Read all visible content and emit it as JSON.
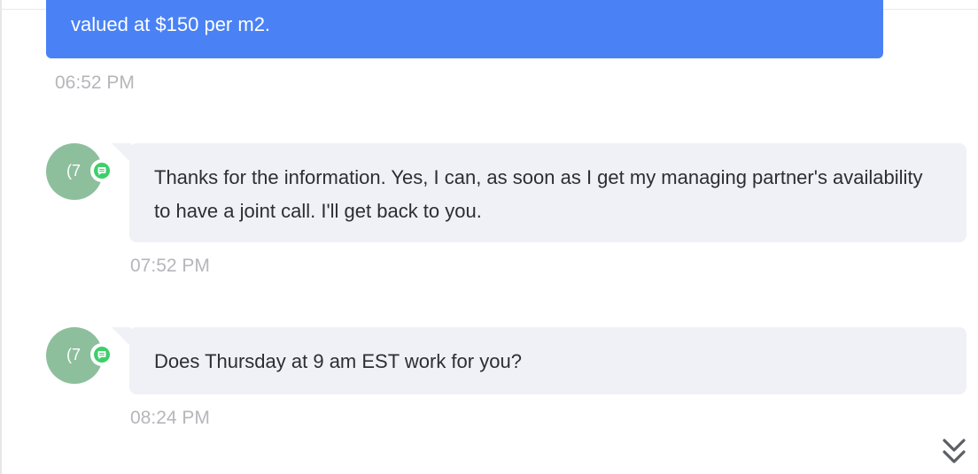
{
  "messages": {
    "outgoing_1": {
      "text": "valued at $150 per m2.",
      "time": "06:52 PM"
    },
    "incoming_1": {
      "avatar_initials": "(7",
      "text": "Thanks for the information. Yes, I can, as soon as I get my managing partner's availability to have a joint call. I'll get back to you.",
      "time": "07:52 PM"
    },
    "incoming_2": {
      "avatar_initials": "(7",
      "text": "Does Thursday at 9 am EST work for you?",
      "time": "08:24 PM"
    }
  },
  "icons": {
    "channel_badge": "chat-bubble-icon",
    "scroll_down": "double-chevron-down-icon"
  },
  "colors": {
    "outgoing_bubble": "#4a82f5",
    "incoming_bubble": "#f0f1f6",
    "avatar": "#8dbf9d",
    "channel_badge": "#3ecf6a",
    "timestamp": "#b6b6bb"
  }
}
